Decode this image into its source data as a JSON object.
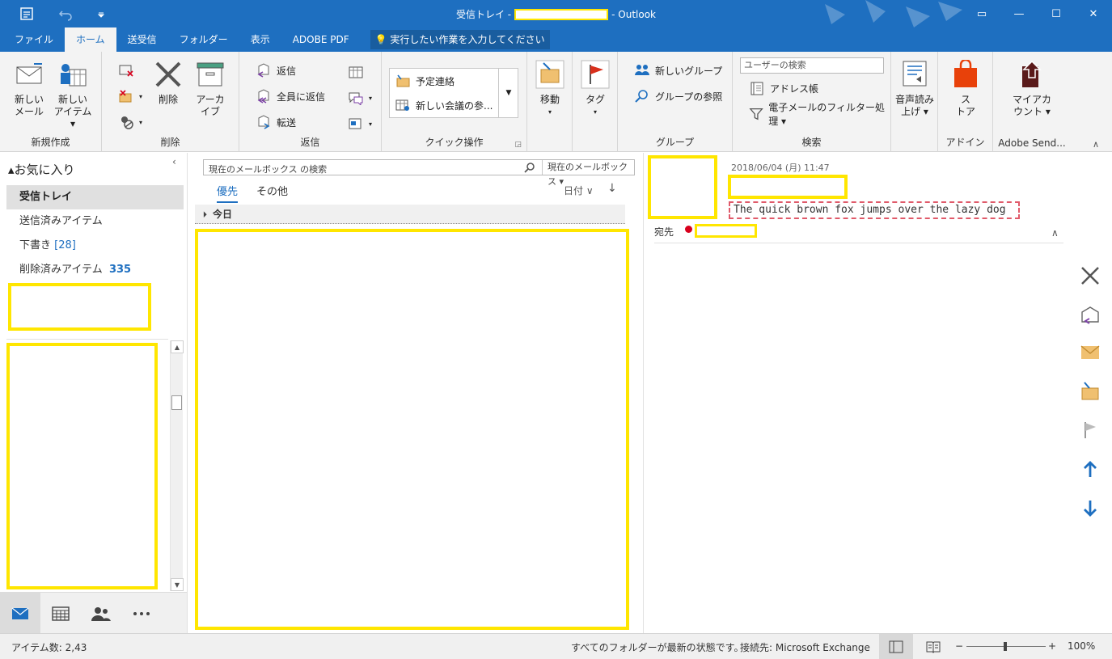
{
  "window": {
    "title_prefix": "受信トレイ -",
    "title_suffix": "- Outlook",
    "controls": [
      "▭",
      "—",
      "☐",
      "✕"
    ]
  },
  "tabs": [
    {
      "label": "ファイル"
    },
    {
      "label": "ホーム"
    },
    {
      "label": "送受信"
    },
    {
      "label": "フォルダー"
    },
    {
      "label": "表示"
    },
    {
      "label": "ADOBE PDF"
    }
  ],
  "tellme": {
    "label": "実行したい作業を入力してください"
  },
  "ribbon": {
    "new": {
      "group": "新規作成",
      "new_mail": "新しい\nメール",
      "new_items": "新しい\nアイテム ▾"
    },
    "delete": {
      "group": "削除",
      "delete": "削除",
      "archive": "アーカ\nイブ"
    },
    "respond": {
      "group": "返信",
      "reply": "返信",
      "reply_all": "全員に返信",
      "forward": "転送"
    },
    "quick": {
      "group": "クイック操作",
      "item1": "予定連絡",
      "item2": "新しい会議の参..."
    },
    "move": {
      "label": "移動",
      "dropdown": "▾"
    },
    "tags": {
      "label": "タグ",
      "dropdown": "▾"
    },
    "groups": {
      "group": "グループ",
      "new_group": "新しいグループ",
      "browse": "グループの参照"
    },
    "find": {
      "group": "検索",
      "search_people": "ユーザーの検索",
      "address_book": "アドレス帳",
      "filter": "電子メールのフィルター処理 ▾"
    },
    "speech": {
      "label": "音声読み\n上げ ▾"
    },
    "addins": {
      "group": "アドイン",
      "store": "ス\nトア"
    },
    "adobe": {
      "group": "Adobe Send...",
      "account": "マイアカ\nウント ▾"
    }
  },
  "folders": {
    "favorites": "お気に入り",
    "items": [
      {
        "label": "受信トレイ",
        "count": ""
      },
      {
        "label": "送信済みアイテム",
        "count": ""
      },
      {
        "label": "下書き",
        "count": "[28]"
      },
      {
        "label": "削除済みアイテム",
        "count": "335"
      }
    ]
  },
  "list": {
    "search_placeholder": "現在のメールボックス の検索",
    "scope": "現在のメールボックス",
    "tab_focused": "優先",
    "tab_other": "その他",
    "sort": "日付 ∨",
    "sort_arrow": "↓",
    "group_header": "今日"
  },
  "reading": {
    "date": "2018/06/04 (月) 11:47",
    "subject": "The quick brown fox jumps over the lazy dog",
    "to_label": "宛先"
  },
  "status": {
    "items": "アイテム数: 2,43",
    "sync": "すべてのフォルダーが最新の状態です。",
    "connection": "接続先: Microsoft Exchange",
    "zoom_minus": "−",
    "zoom_plus": "+",
    "zoom": "100%"
  },
  "colors": {
    "accent": "#1e6fc0",
    "redact": "#ffe600",
    "unread_dot": "#d8001c"
  }
}
